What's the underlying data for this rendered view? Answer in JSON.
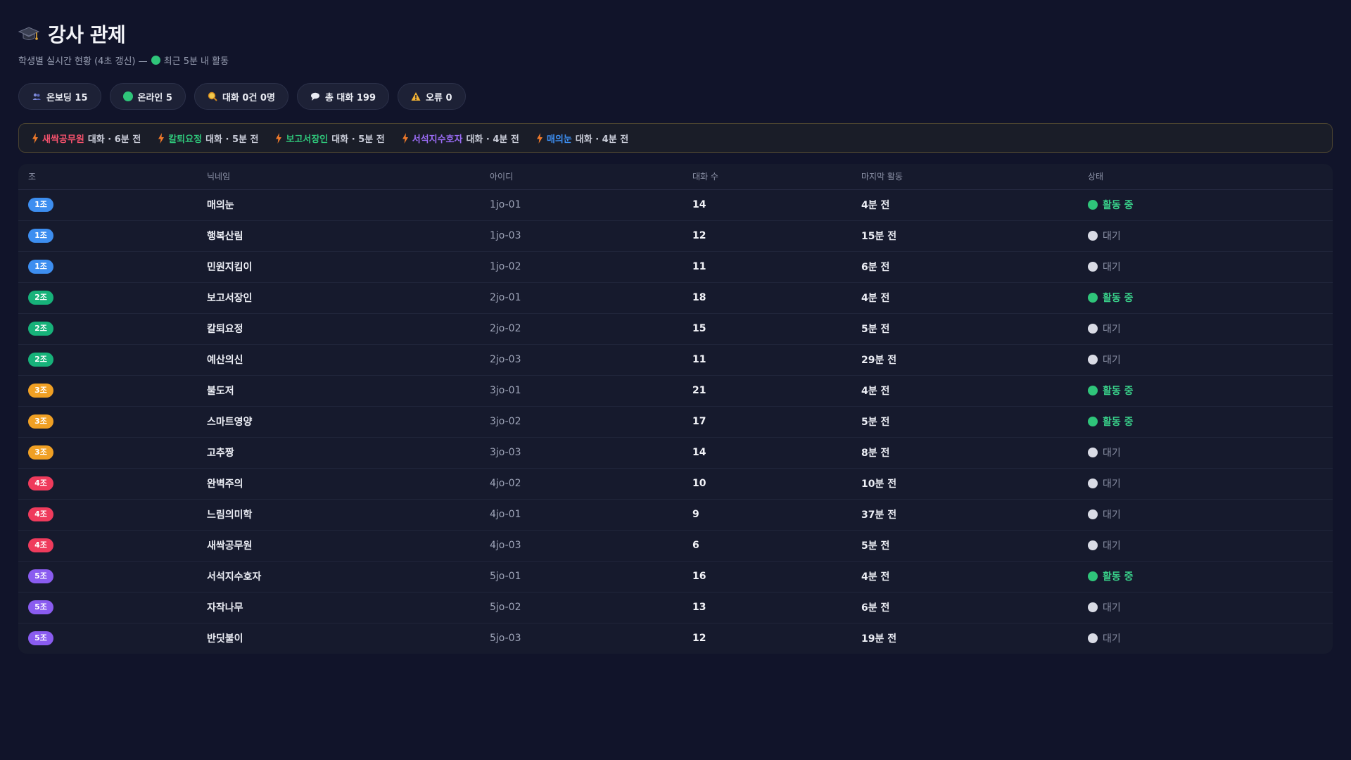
{
  "header": {
    "title": "강사 관제",
    "subtitle_prefix": "학생별 실시간 현황 (4초 갱신) —",
    "subtitle_suffix": "최근 5분 내 활동"
  },
  "pills": [
    {
      "name": "onboarding",
      "label": "온보딩 15",
      "icon": "people-icon"
    },
    {
      "name": "online",
      "label": "온라인 5",
      "icon": "green-dot-icon"
    },
    {
      "name": "zero-chat",
      "label": "대화 0건 0명",
      "icon": "search-icon"
    },
    {
      "name": "total-chat",
      "label": "총 대화 199",
      "icon": "chat-bubble-icon"
    },
    {
      "name": "errors",
      "label": "오류 0",
      "icon": "warning-icon"
    }
  ],
  "feed": [
    {
      "name": "새싹공무원",
      "desc": "대화 · 6분 전",
      "color": "#f4516c"
    },
    {
      "name": "칼퇴요정",
      "desc": "대화 · 5분 전",
      "color": "#2fc57a"
    },
    {
      "name": "보고서장인",
      "desc": "대화 · 5분 전",
      "color": "#2fc57a"
    },
    {
      "name": "서석지수호자",
      "desc": "대화 · 4분 전",
      "color": "#9b6cf6"
    },
    {
      "name": "매의눈",
      "desc": "대화 · 4분 전",
      "color": "#3d8ef0"
    }
  ],
  "table": {
    "columns": [
      "조",
      "닉네임",
      "아이디",
      "대화 수",
      "마지막 활동",
      "상태"
    ],
    "group_colors": {
      "1조": "#3d8ef0",
      "2조": "#17b27a",
      "3조": "#f0a024",
      "4조": "#ef3b5c",
      "5조": "#8a5cf0"
    },
    "status_colors": {
      "active": "#2fc57a",
      "idle": "#d9dbe5"
    },
    "rows": [
      {
        "group": "1조",
        "nick": "매의눈",
        "id": "1jo-01",
        "count": "14",
        "last": "4분 전",
        "status": "활동 중",
        "active": true
      },
      {
        "group": "1조",
        "nick": "행복산림",
        "id": "1jo-03",
        "count": "12",
        "last": "15분 전",
        "status": "대기",
        "active": false
      },
      {
        "group": "1조",
        "nick": "민원지킴이",
        "id": "1jo-02",
        "count": "11",
        "last": "6분 전",
        "status": "대기",
        "active": false
      },
      {
        "group": "2조",
        "nick": "보고서장인",
        "id": "2jo-01",
        "count": "18",
        "last": "4분 전",
        "status": "활동 중",
        "active": true
      },
      {
        "group": "2조",
        "nick": "칼퇴요정",
        "id": "2jo-02",
        "count": "15",
        "last": "5분 전",
        "status": "대기",
        "active": false
      },
      {
        "group": "2조",
        "nick": "예산의신",
        "id": "2jo-03",
        "count": "11",
        "last": "29분 전",
        "status": "대기",
        "active": false
      },
      {
        "group": "3조",
        "nick": "불도저",
        "id": "3jo-01",
        "count": "21",
        "last": "4분 전",
        "status": "활동 중",
        "active": true
      },
      {
        "group": "3조",
        "nick": "스마트영양",
        "id": "3jo-02",
        "count": "17",
        "last": "5분 전",
        "status": "활동 중",
        "active": true
      },
      {
        "group": "3조",
        "nick": "고추짱",
        "id": "3jo-03",
        "count": "14",
        "last": "8분 전",
        "status": "대기",
        "active": false
      },
      {
        "group": "4조",
        "nick": "완벽주의",
        "id": "4jo-02",
        "count": "10",
        "last": "10분 전",
        "status": "대기",
        "active": false
      },
      {
        "group": "4조",
        "nick": "느림의미학",
        "id": "4jo-01",
        "count": "9",
        "last": "37분 전",
        "status": "대기",
        "active": false
      },
      {
        "group": "4조",
        "nick": "새싹공무원",
        "id": "4jo-03",
        "count": "6",
        "last": "5분 전",
        "status": "대기",
        "active": false
      },
      {
        "group": "5조",
        "nick": "서석지수호자",
        "id": "5jo-01",
        "count": "16",
        "last": "4분 전",
        "status": "활동 중",
        "active": true
      },
      {
        "group": "5조",
        "nick": "자작나무",
        "id": "5jo-02",
        "count": "13",
        "last": "6분 전",
        "status": "대기",
        "active": false
      },
      {
        "group": "5조",
        "nick": "반딧불이",
        "id": "5jo-03",
        "count": "12",
        "last": "19분 전",
        "status": "대기",
        "active": false
      }
    ]
  }
}
